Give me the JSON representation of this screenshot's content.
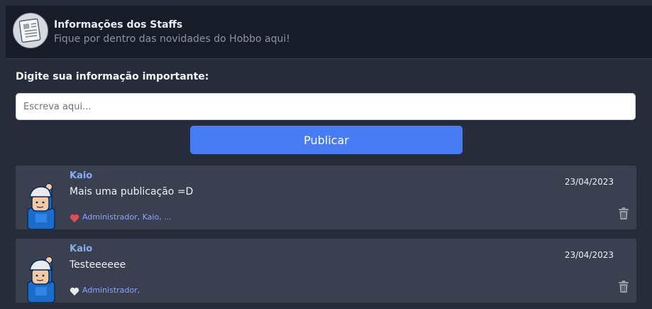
{
  "header": {
    "title": "Informações dos Staffs",
    "subtitle": "Fique por dentro das novidades do Hobbo aqui!",
    "icon": "newspaper-icon"
  },
  "form": {
    "label": "Digite sua informação importante:",
    "placeholder": "Escreva aqui...",
    "value": "",
    "publish_label": "Publicar"
  },
  "posts": [
    {
      "author": "Kaio",
      "message": "Mais uma publicação =D",
      "date": "23/04/2023",
      "liked": true,
      "likes_text": "Administrador, Kaio, ..."
    },
    {
      "author": "Kaio",
      "message": "Testeeeeee",
      "date": "23/04/2023",
      "liked": false,
      "likes_text": "Administrador,"
    }
  ],
  "colors": {
    "accent": "#4a7bf7",
    "author": "#86aef5",
    "like_names": "#8aa4ff",
    "heart_liked": "#e24c55",
    "heart_unliked": "#e8eaee",
    "card": "#3a4050",
    "background": "#272c3a"
  }
}
